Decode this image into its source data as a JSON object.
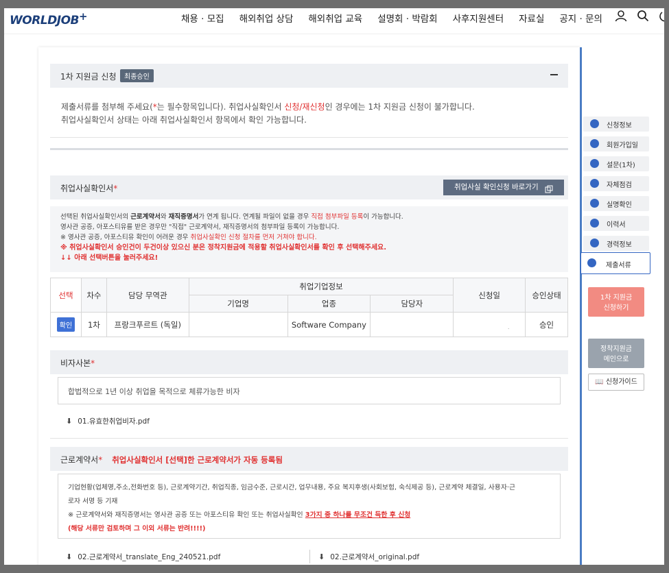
{
  "header": {
    "logo": "WORLDJOB",
    "logo_plus": "+",
    "menu": [
      "채용 · 모집",
      "해외취업 상담",
      "해외취업 교육",
      "설명회 · 박람회",
      "사후지원센터",
      "자료실",
      "공지 · 문의"
    ],
    "icons": [
      "user-icon",
      "search-icon",
      "power-icon"
    ]
  },
  "section1": {
    "title": "1차 지원금 신청",
    "badge": "최종승인",
    "line1_a": "제출서류를 첨부해 주세요(",
    "line1_star": "*",
    "line1_b": "는 필수항목입니다).   취업사실확인서 ",
    "line1_red": "신청/재신청",
    "line1_c": "인 경우에는 1차 지원금 신청이 불가합니다.",
    "line2": "취업사실확인서 상태는 아래 취업사실확인서 항목에서 확인 가능합니다."
  },
  "employment": {
    "title": "취업사실확인서",
    "star": "*",
    "button": "취업사실 확인신청 바로가기",
    "notice": {
      "l1_a": "선택된 취업사실확인서의 ",
      "l1_b1": "근로계약서",
      "l1_and": "와 ",
      "l1_b2": "재직증명서",
      "l1_c": "가 연계 됩니다. 연계될 파일이 없을 경우 ",
      "l1_red": "직접 첨부파일 등록",
      "l1_d": "이 가능합니다.",
      "l2": "영사관 공증, 아포스티유를 받은 경우만 \"직접\" 근로계약서, 재직증명서의 첨부파일 등록이 가능합니다.",
      "l3_a": "※ 영사관 공증, 아포스티유 확인이 어려운 경우 ",
      "l3_red": "취업사실확인 신청 절차를 먼저 거쳐야 합니다.",
      "l4": "※ 취업사실확인서 승인건이 두건이상 있으신 분은 정착지원금에 적용할 취업사실확인서를 확인 후 선택해주세요.",
      "l5": "↓↓ 아래 선택버튼을 눌러주세요!"
    },
    "table": {
      "headers": {
        "select": "선택",
        "round": "차수",
        "officer": "담당 무역관",
        "company_info": "취업기업정보",
        "company": "기업명",
        "industry": "업종",
        "manager": "담당자",
        "apply_date": "신청일",
        "status": "승인상태"
      },
      "rows": [
        {
          "select_btn": "확인",
          "round": "1차",
          "officer": "프랑크푸르트 (독일)",
          "company": "",
          "industry": "Software Company",
          "manager": "",
          "apply_date": ".",
          "status": "승인"
        }
      ]
    }
  },
  "visa": {
    "title": "비자사본",
    "star": "*",
    "desc": "합법적으로 1년 이상 취업을 목적으로 체류가능한 비자",
    "file": "01.유효한취업비자.pdf"
  },
  "contract": {
    "title": "근로계약서",
    "star": "*",
    "auto_note": "취업사실확인서 [선택]한 근로계약서가 자동 등록됨",
    "box_l1": "기업현황(업체명,주소,전화번호 등), 근로계약기간, 취업직종, 임금수준, 근로시간, 업무내용, 주요 복지후생(사회보험, 숙식제공 등), 근로계약 체결일, 사용자·근",
    "box_l2": "로자 서명 등 기재",
    "box_l3_a": "※ 근로계약서와 재직증명서는 영사관 공증 또는 아포스티유 확인 또는 취업사실확인 ",
    "box_l3_red": "3가지 중 하나를 무조건 득한 후 신청",
    "box_l4": "(해당 서류만 검토하며 그 이외 서류는 반려!!!!)",
    "files": [
      "02.근로계약서_translate_Eng_240521.pdf",
      "02.근로계약서_original.pdf"
    ]
  },
  "sidenav": {
    "items": [
      "신청정보",
      "회원가입일",
      "설문(1차)",
      "자체점검",
      "실명확인",
      "이력서",
      "경력정보",
      "제출서류"
    ],
    "active_index": 7,
    "apply_button": [
      "1차 지원금",
      "신청하기"
    ],
    "settle_button": [
      "정착지원금",
      "메인으로"
    ],
    "guide_button": "신청가이드"
  },
  "colors": {
    "accent": "#3466c2",
    "red": "#e03131",
    "apply_btn": "#f28b82",
    "settle_btn": "#9aa3ad"
  }
}
